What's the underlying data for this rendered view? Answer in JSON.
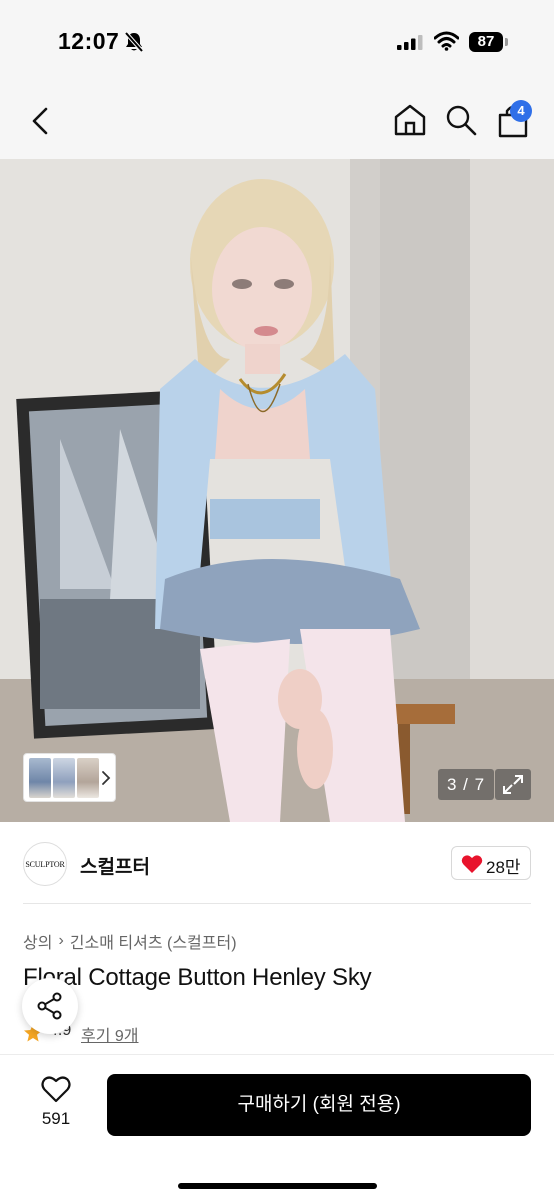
{
  "status_bar": {
    "time": "12:07",
    "battery": "87",
    "icons": [
      "bell-slash-icon",
      "cellular-signal-icon",
      "wifi-icon",
      "battery-icon"
    ]
  },
  "nav": {
    "icons": [
      "chevron-left-icon",
      "home-icon",
      "search-icon",
      "shopping-bag-icon"
    ],
    "cart_badge": "4",
    "accent_color": "#2f6fe8"
  },
  "gallery": {
    "counter": "3 / 7",
    "icons": [
      "chevron-right-icon",
      "expand-icon"
    ]
  },
  "brand": {
    "logo_text": "SCULPTOR",
    "name": "스컬프터",
    "likes": "28만",
    "heart_color": "#e8132c"
  },
  "product": {
    "category": "상의",
    "subcategory": "긴소매 티셔츠 (스컬프터)",
    "title": "Floral Cottage Button Henley Sky",
    "rating": "4.9",
    "reviews": "후기 9개",
    "star_color": "#f5a623"
  },
  "bottom_bar": {
    "wish_count": "591",
    "buy_label": "구매하기 (회원 전용)"
  }
}
